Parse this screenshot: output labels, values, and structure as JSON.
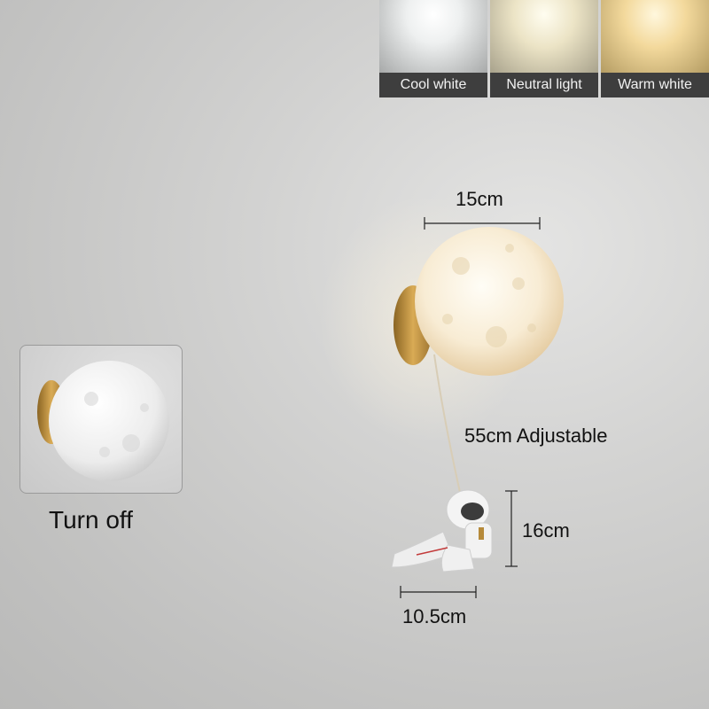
{
  "color_temperatures": [
    {
      "label": "Cool white",
      "color": "#ffffff"
    },
    {
      "label": "Neutral light",
      "color": "#f5efd8"
    },
    {
      "label": "Warm white",
      "color": "#f8df9f"
    }
  ],
  "inset": {
    "caption": "Turn off"
  },
  "dimensions": {
    "moon_width": "15cm",
    "cord_length": "55cm Adjustable",
    "astronaut_height": "16cm",
    "astronaut_width": "10.5cm"
  }
}
